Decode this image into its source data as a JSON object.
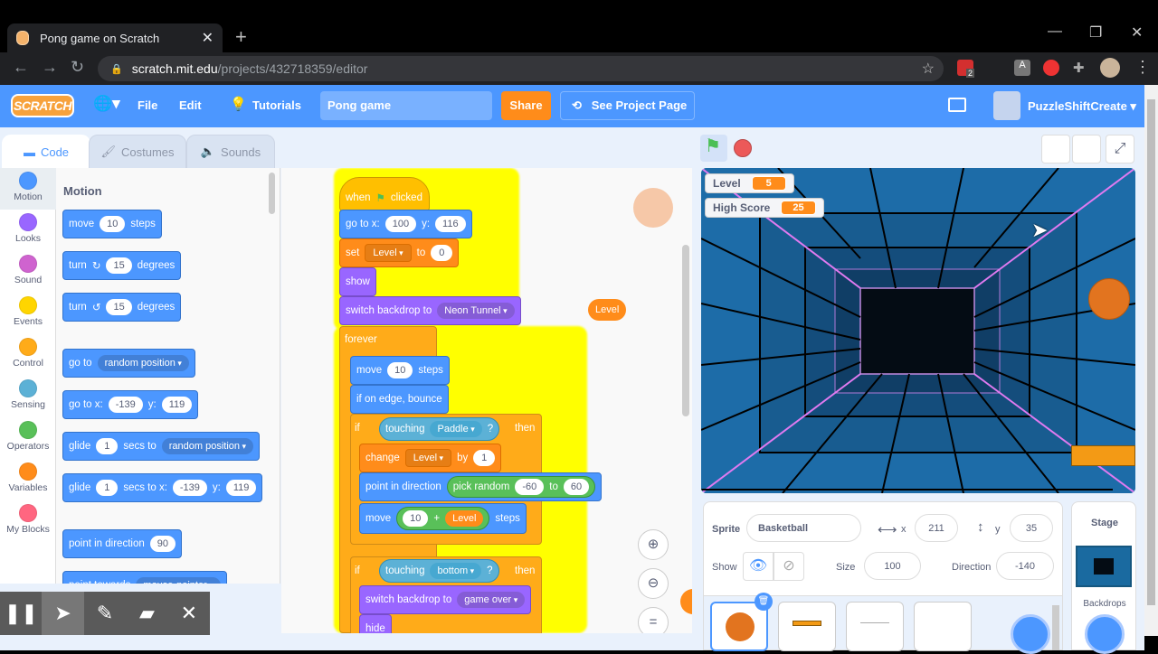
{
  "browser": {
    "tab_title": "Pong game on Scratch",
    "url_host": "scratch.mit.edu",
    "url_path": "/projects/432718359/editor",
    "extension_badge": "2"
  },
  "menubar": {
    "logo": "SCRATCH",
    "file": "File",
    "edit": "Edit",
    "tutorials": "Tutorials",
    "project_title": "Pong game",
    "share": "Share",
    "see_project_page": "See Project Page",
    "username": "PuzzleShiftCreate"
  },
  "editor_tabs": [
    {
      "label": "Code",
      "active": true
    },
    {
      "label": "Costumes",
      "active": false
    },
    {
      "label": "Sounds",
      "active": false
    }
  ],
  "categories": [
    {
      "label": "Motion",
      "color": "#4c97ff"
    },
    {
      "label": "Looks",
      "color": "#9966ff"
    },
    {
      "label": "Sound",
      "color": "#cf63cf"
    },
    {
      "label": "Events",
      "color": "#ffd500"
    },
    {
      "label": "Control",
      "color": "#ffab19"
    },
    {
      "label": "Sensing",
      "color": "#5cb1d6"
    },
    {
      "label": "Operators",
      "color": "#59c059"
    },
    {
      "label": "Variables",
      "color": "#ff8c1a"
    },
    {
      "label": "My Blocks",
      "color": "#ff6680"
    }
  ],
  "palette": {
    "title": "Motion",
    "blocks": {
      "move": {
        "t1": "move",
        "v": "10",
        "t2": "steps"
      },
      "turn_right": {
        "t1": "turn",
        "v": "15",
        "t2": "degrees"
      },
      "turn_left": {
        "t1": "turn",
        "v": "15",
        "t2": "degrees"
      },
      "goto": {
        "t1": "go to",
        "d": "random position"
      },
      "gotoxy": {
        "t1": "go to x:",
        "x": "-139",
        "t2": "y:",
        "y": "119"
      },
      "glide_to": {
        "t1": "glide",
        "v": "1",
        "t2": "secs to",
        "d": "random position"
      },
      "glide_xy": {
        "t1": "glide",
        "v": "1",
        "t2": "secs to x:",
        "x": "-139",
        "t3": "y:",
        "y": "119"
      },
      "point_dir": {
        "t1": "point in direction",
        "v": "90"
      },
      "point_towards": {
        "t1": "point towards",
        "d": "mouse-pointer"
      }
    }
  },
  "script": {
    "when": "when",
    "clicked": "clicked",
    "goto_t": "go to x:",
    "goto_x": "100",
    "goto_yl": "y:",
    "goto_y": "116",
    "set_t": "set",
    "set_var": "Level",
    "set_to": "to",
    "set_val": "0",
    "show": "show",
    "switch_t": "switch backdrop to",
    "backdrop1": "Neon Tunnel",
    "forever": "forever",
    "move_t": "move",
    "move_v": "10",
    "move_s": "steps",
    "bounce": "if on edge, bounce",
    "if1": "if",
    "touching": "touching",
    "touch1": "Paddle",
    "q": "?",
    "then": "then",
    "change_t": "change",
    "change_var": "Level",
    "change_by": "by",
    "change_v": "1",
    "point_t": "point in direction",
    "pick": "pick random",
    "pick_a": "-60",
    "pick_to": "to",
    "pick_b": "60",
    "move2_t": "move",
    "move2_a": "10",
    "plus": "+",
    "move2_var": "Level",
    "move2_s": "steps",
    "if2": "if",
    "touch2": "bottom",
    "backdrop2": "game over",
    "hide": "hide",
    "floating_var": "Level"
  },
  "stage": {
    "monitors": [
      {
        "label": "Level",
        "value": "5"
      },
      {
        "label": "High Score",
        "value": "25"
      }
    ]
  },
  "sprite_info": {
    "sprite_label": "Sprite",
    "sprite_name": "Basketball",
    "x_label": "x",
    "x": "211",
    "y_label": "y",
    "y": "35",
    "show_label": "Show",
    "size_label": "Size",
    "size": "100",
    "direction_label": "Direction",
    "direction": "-140"
  },
  "stage_pane": {
    "title": "Stage",
    "backdrops_label": "Backdrops"
  }
}
